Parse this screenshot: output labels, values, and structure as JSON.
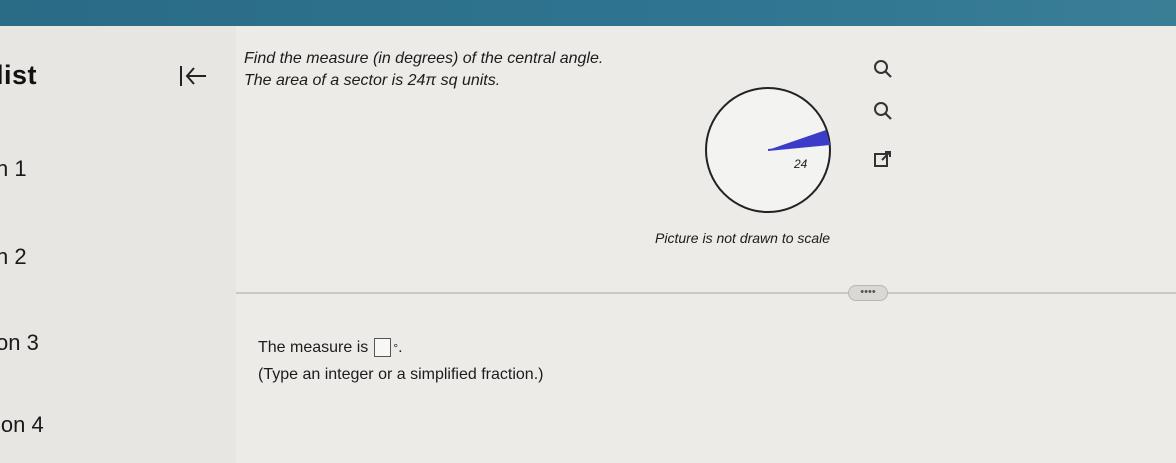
{
  "sidebar": {
    "title": "list",
    "items": [
      {
        "label": "n 1"
      },
      {
        "label": "n 2"
      },
      {
        "label": "on 3"
      },
      {
        "label": "ion 4"
      }
    ]
  },
  "question": {
    "prompt": "Find the measure (in degrees) of the central angle.",
    "given": "The area of a sector is 24π sq units.",
    "radius_label": "24",
    "figure_note": "Picture is not drawn to scale"
  },
  "more_label": "••••",
  "answer": {
    "prefix": "The measure is",
    "suffix": ".",
    "hint": "(Type an integer or a simplified fraction.)"
  },
  "colors": {
    "topbar": "#2f7591",
    "sector": "#3d3cc8"
  }
}
